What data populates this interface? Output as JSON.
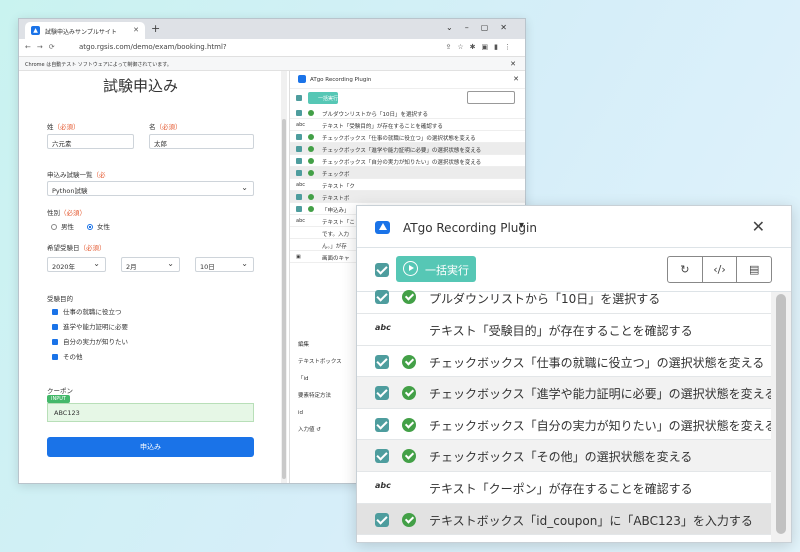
{
  "browser": {
    "tab_title": "試験申込みサンプルサイト",
    "url": "atgo.rgsis.com/demo/exam/booking.html?",
    "infobar": "Chrome は自動テスト ソフトウェアによって制御されています。"
  },
  "form": {
    "title": "試験申込み",
    "last_name_label": "姓",
    "first_name_label": "名",
    "required": "（必須）",
    "required_short": "（必",
    "last_name_value": "六元素",
    "first_name_value": "太郎",
    "exam_list_label": "申込み試験一覧",
    "exam_value": "Python試験",
    "gender_label": "性別",
    "gender_male": "男性",
    "gender_female": "女性",
    "date_label": "希望受験日",
    "year_value": "2020年",
    "month_value": "2月",
    "day_value": "10日",
    "purpose_label": "受験目的",
    "purposes": [
      "仕事の就職に役立つ",
      "進学や能力証明に必要",
      "自分の実力が知りたい",
      "その他"
    ],
    "coupon_label": "クーポン",
    "coupon_badge": "INPUT",
    "coupon_value": "ABC123",
    "submit_label": "申込み"
  },
  "mini_panel": {
    "title": "ATgo Recording Plugin",
    "run_label": "一括実行",
    "rows": [
      "ブルダウンリストから「10日」を選択する",
      "テキスト「受験目的」が存在することを確認する",
      "チェックボックス「仕事の就職に役立つ」の選択状態を変える",
      "チェックボックス「進学や能力証明に必要」の選択状態を変える",
      "チェックボックス「自分の実力が知りたい」の選択状態を変える",
      "チェックボ",
      "テキスト「ク",
      "テキストボ",
      "「申込み」",
      "テキスト「こ",
      "です。入力",
      "ん。」が存",
      "画面のキャ"
    ],
    "edit_labels": [
      "編集",
      "テキストボックス「id",
      "要素特定方法",
      "id",
      "入力値 ↺"
    ]
  },
  "plugin": {
    "title": "ATgo Recording Plugin",
    "run_label": "一括実行",
    "icons": [
      "refresh-icon",
      "code-icon",
      "save-icon"
    ],
    "steps": [
      {
        "type": "check",
        "text": "プルダウンリストから「10日」を選択する"
      },
      {
        "type": "text",
        "text": "テキスト「受験目的」が存在することを確認する"
      },
      {
        "type": "check",
        "text": "チェックボックス「仕事の就職に役立つ」の選択状態を変える"
      },
      {
        "type": "check",
        "text": "チェックボックス「進学や能力証明に必要」の選択状態を変える"
      },
      {
        "type": "check",
        "text": "チェックボックス「自分の実力が知りたい」の選択状態を変える"
      },
      {
        "type": "check",
        "text": "チェックボックス「その他」の選択状態を変える"
      },
      {
        "type": "text",
        "text": "テキスト「クーポン」が存在することを確認する"
      },
      {
        "type": "check",
        "text": "テキストボックス「id_coupon」に「ABC123」を入力する"
      }
    ]
  }
}
